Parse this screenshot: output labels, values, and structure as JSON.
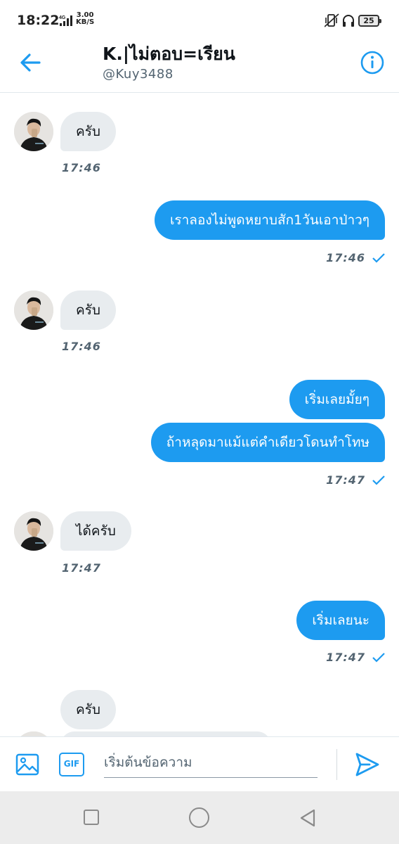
{
  "status_bar": {
    "time": "18:22",
    "network": "4G",
    "speed_value": "3.00",
    "speed_unit": "KB/S",
    "battery": "25"
  },
  "header": {
    "title": "K.|ไม่ตอบ=เรียน",
    "handle": "@Kuy3488",
    "back_icon": "arrow-left-icon",
    "info_icon": "info-circle-icon"
  },
  "messages": [
    {
      "direction": "in",
      "text": "ครับ",
      "time": "17:46"
    },
    {
      "direction": "out",
      "text": "เราลองไม่พูดหยาบสัก1วันเอาป่าวๆ",
      "time": "17:46",
      "read": true
    },
    {
      "direction": "in",
      "text": "ครับ",
      "time": "17:46"
    },
    {
      "direction": "out",
      "text": "เริ่มเลยมั้ยๆ"
    },
    {
      "direction": "out",
      "text": "ถ้าหลุดมาแม้แต่คำเดียวโดนทำโทษ",
      "time": "17:47",
      "read": true
    },
    {
      "direction": "in",
      "text": "ได้ครับ",
      "time": "17:47"
    },
    {
      "direction": "out",
      "text": "เริ่มเลยนะ",
      "time": "17:47",
      "read": true
    },
    {
      "direction": "in",
      "text": "ครับ"
    }
  ],
  "composer": {
    "gif_label": "GIF",
    "placeholder": "เริ่มต้นข้อความ",
    "media_icon": "image-icon",
    "send_icon": "send-icon"
  },
  "colors": {
    "accent": "#1d9bf0",
    "incoming_bubble": "#e8ecef",
    "outgoing_bubble": "#1d9bf0",
    "secondary_text": "#536471"
  }
}
